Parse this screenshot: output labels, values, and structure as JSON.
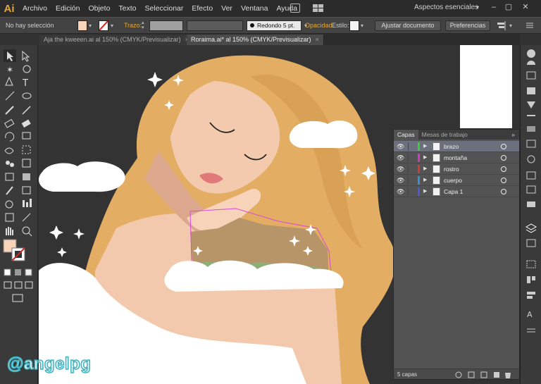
{
  "app": {
    "logo": "Ai",
    "workspace": "Aspectos esenciales"
  },
  "menu": [
    "Archivo",
    "Edición",
    "Objeto",
    "Texto",
    "Seleccionar",
    "Efecto",
    "Ver",
    "Ventana",
    "Ayuda"
  ],
  "control_bar": {
    "selection": "No hay selección",
    "stroke_label": "Trazo:",
    "brush": "Redondo 5 pt.",
    "opacity_label": "Opacidad",
    "style_label": "Estilo:",
    "adjust_button": "Ajustar documento",
    "prefs_button": "Preferencias"
  },
  "tabs": [
    {
      "label": "Aja the kweeen.ai al 150% (CMYK/Previsualizar)",
      "close": "×"
    },
    {
      "label": "Roraima.ai* al 150% (CMYK/Previsualizar)",
      "close": "×"
    }
  ],
  "layers_panel": {
    "tabs": [
      "Capas",
      "Mesas de trabajo"
    ],
    "layers": [
      {
        "name": "brazo",
        "color": "#3ec83e"
      },
      {
        "name": "montaña",
        "color": "#c63ec6"
      },
      {
        "name": "rostro",
        "color": "#d63a3a"
      },
      {
        "name": "cuerpo",
        "color": "#3a8ed6"
      },
      {
        "name": "Capa 1",
        "color": "#4a5ad6"
      }
    ],
    "footer": "5 capas"
  },
  "colors": {
    "accent_fill": "#f6d3b9",
    "hair": "#e3ad63",
    "skin": "#f3c9ad",
    "selection_outline": "#d84bd8"
  },
  "watermark": "@angelpg"
}
